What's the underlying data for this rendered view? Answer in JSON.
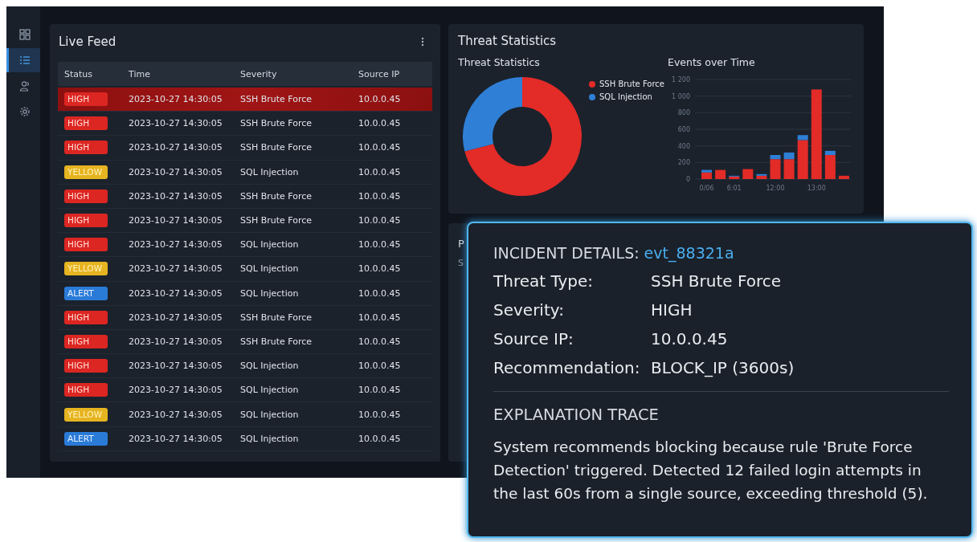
{
  "sidebar": {
    "items": [
      {
        "kind": "grid",
        "selected": false
      },
      {
        "kind": "list",
        "selected": true
      },
      {
        "kind": "users",
        "selected": false
      },
      {
        "kind": "gear",
        "selected": false
      }
    ]
  },
  "live_feed": {
    "title": "Live Feed",
    "columns": [
      "Status",
      "Time",
      "Severity",
      "Source IP"
    ],
    "rows": [
      {
        "status": "HIGH",
        "kind": "high",
        "time": "2023-10-27 14:30:05",
        "severity": "SSH Brute Force",
        "source_ip": "10.0.0.45",
        "selected": true
      },
      {
        "status": "HIGH",
        "kind": "high",
        "time": "2023-10-27 14:30:05",
        "severity": "SSH Brute Force",
        "source_ip": "10.0.0.45",
        "selected": false
      },
      {
        "status": "HIGH",
        "kind": "high",
        "time": "2023-10-27 14:30:05",
        "severity": "SSH Brute Force",
        "source_ip": "10.0.0.45",
        "selected": false
      },
      {
        "status": "YELLOW",
        "kind": "yellow",
        "time": "2023-10-27 14:30:05",
        "severity": "SQL Injection",
        "source_ip": "10.0.0.45",
        "selected": false
      },
      {
        "status": "HIGH",
        "kind": "high",
        "time": "2023-10-27 14:30:05",
        "severity": "SSH Brute Force",
        "source_ip": "10.0.0.45",
        "selected": false
      },
      {
        "status": "HIGH",
        "kind": "high",
        "time": "2023-10-27 14:30:05",
        "severity": "SSH Brute Force",
        "source_ip": "10.0.0.45",
        "selected": false
      },
      {
        "status": "HIGH",
        "kind": "high",
        "time": "2023-10-27 14:30:05",
        "severity": "SQL Injection",
        "source_ip": "10.0.0.45",
        "selected": false
      },
      {
        "status": "YELLOW",
        "kind": "yellow",
        "time": "2023-10-27 14:30:05",
        "severity": "SQL Injection",
        "source_ip": "10.0.0.45",
        "selected": false
      },
      {
        "status": "ALERT",
        "kind": "alert",
        "time": "2023-10-27 14:30:05",
        "severity": "SQL Injection",
        "source_ip": "10.0.0.45",
        "selected": false
      },
      {
        "status": "HIGH",
        "kind": "high",
        "time": "2023-10-27 14:30:05",
        "severity": "SSH Brute Force",
        "source_ip": "10.0.0.45",
        "selected": false
      },
      {
        "status": "HIGH",
        "kind": "high",
        "time": "2023-10-27 14:30:05",
        "severity": "SSH Brute Force",
        "source_ip": "10.0.0.45",
        "selected": false
      },
      {
        "status": "HIGH",
        "kind": "high",
        "time": "2023-10-27 14:30:05",
        "severity": "SQL Injection",
        "source_ip": "10.0.0.45",
        "selected": false
      },
      {
        "status": "HIGH",
        "kind": "high",
        "time": "2023-10-27 14:30:05",
        "severity": "SQL Injection",
        "source_ip": "10.0.0.45",
        "selected": false
      },
      {
        "status": "YELLOW",
        "kind": "yellow",
        "time": "2023-10-27 14:30:05",
        "severity": "SQL Injection",
        "source_ip": "10.0.0.45",
        "selected": false
      },
      {
        "status": "ALERT",
        "kind": "alert",
        "time": "2023-10-27 14:30:05",
        "severity": "SQL Injection",
        "source_ip": "10.0.0.45",
        "selected": false
      }
    ]
  },
  "threat_statistics": {
    "title": "Threat Statistics",
    "donut": {
      "chart_data": {
        "type": "donut",
        "title": "Threat Statistics",
        "categories": [
          "SSH Brute Force",
          "SQL Injection"
        ],
        "values": [
          71,
          29
        ],
        "colors": [
          "#e32b27",
          "#2f7fd6"
        ],
        "legend": "right"
      }
    },
    "events": {
      "chart_data": {
        "type": "bar",
        "title": "Events over Time",
        "stacked": true,
        "grid": true,
        "categories": [
          "0/06",
          null,
          "6:01",
          null,
          null,
          "12:00",
          null,
          null,
          "13:00",
          null,
          null
        ],
        "series": [
          {
            "color": "#e32b27",
            "values": [
              80,
              110,
              30,
              120,
              40,
              240,
              240,
              470,
              1080,
              290,
              40
            ]
          },
          {
            "color": "#2f7fd6",
            "values": [
              30,
              0,
              10,
              0,
              20,
              50,
              80,
              60,
              0,
              50,
              0
            ]
          }
        ],
        "ylim": [
          0,
          1200
        ],
        "yticks": [
          {
            "value": 0,
            "label": "0"
          },
          {
            "value": 200,
            "label": "200"
          },
          {
            "value": 400,
            "label": "400"
          },
          {
            "value": 600,
            "label": "600"
          },
          {
            "value": 800,
            "label": "800"
          },
          {
            "value": 1000,
            "label": "1 000"
          },
          {
            "value": 1200,
            "label": "1 200"
          }
        ]
      }
    }
  },
  "hidden_panel": {
    "title": "P",
    "subtitle": "S"
  },
  "incident": {
    "title": "INCIDENT DETAILS:",
    "event_id": "evt_88321a",
    "fields": [
      {
        "label": "Threat Type:",
        "value": "SSH Brute Force"
      },
      {
        "label": "Severity:",
        "value": "HIGH"
      },
      {
        "label": "Source IP:",
        "value": "10.0.0.45"
      },
      {
        "label": "Recommendation:",
        "value": "BLOCK_IP (3600s)"
      }
    ],
    "section_title": "EXPLANATION TRACE",
    "explanation": "System recommends blocking because rule 'Brute Force Detection' triggered. Detected 12 failed login attempts in the last 60s from a single source, exceeding threshold (5)."
  }
}
